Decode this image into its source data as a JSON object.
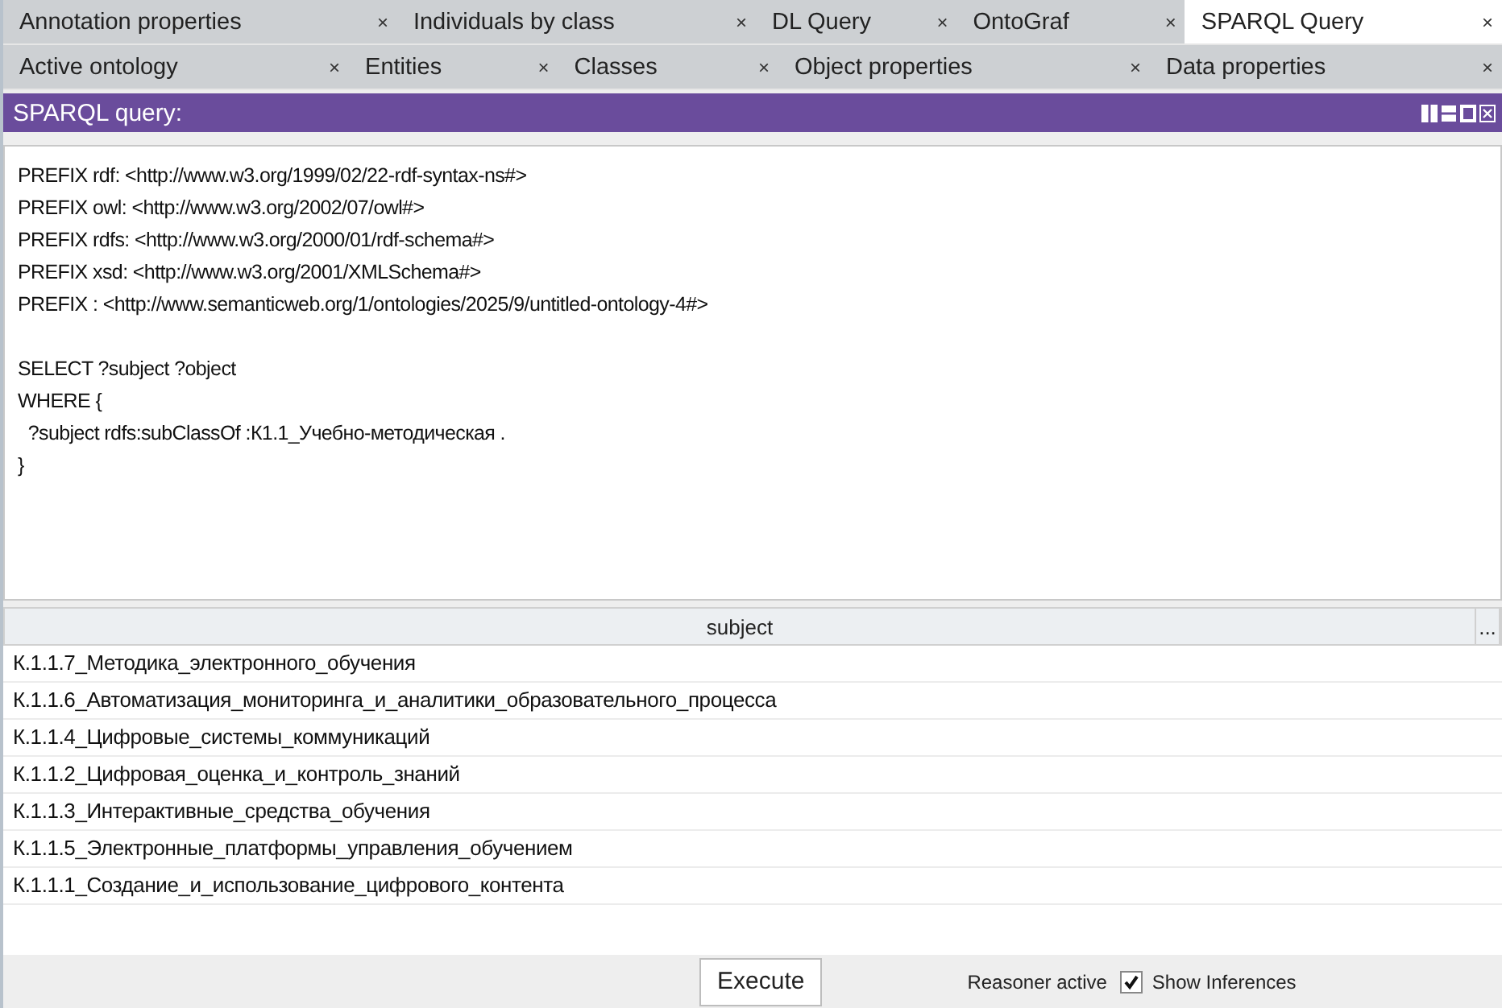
{
  "tab_rows": [
    [
      {
        "label": "Annotation properties",
        "close": "×",
        "selected": false
      },
      {
        "label": "Individuals by class",
        "close": "×",
        "selected": false
      },
      {
        "label": "DL Query",
        "close": "×",
        "selected": false
      },
      {
        "label": "OntoGraf",
        "close": "×",
        "selected": false
      },
      {
        "label": "SPARQL Query",
        "close": "×",
        "selected": true
      }
    ],
    [
      {
        "label": "Active ontology",
        "close": "×",
        "selected": false
      },
      {
        "label": "Entities",
        "close": "×",
        "selected": false
      },
      {
        "label": "Classes",
        "close": "×",
        "selected": false
      },
      {
        "label": "Object properties",
        "close": "×",
        "selected": false
      },
      {
        "label": "Data properties",
        "close": "×",
        "selected": false
      }
    ]
  ],
  "panel": {
    "title": "SPARQL query:"
  },
  "query_blocks": [
    [
      "PREFIX rdf: <http://www.w3.org/1999/02/22-rdf-syntax-ns#>",
      "PREFIX owl: <http://www.w3.org/2002/07/owl#>",
      "PREFIX rdfs: <http://www.w3.org/2000/01/rdf-schema#>",
      "PREFIX xsd: <http://www.w3.org/2001/XMLSchema#>",
      "PREFIX : <http://www.semanticweb.org/1/ontologies/2025/9/untitled-ontology-4#>"
    ],
    [
      "SELECT ?subject ?object",
      "WHERE {",
      "  ?subject rdfs:subClassOf :К1.1_Учебно-методическая .",
      "}"
    ]
  ],
  "table": {
    "columns": [
      "subject",
      "..."
    ],
    "rows": [
      "К.1.1.7_Методика_электронного_обучения",
      "К.1.1.6_Автоматизация_мониторинга_и_аналитики_образовательного_процесса",
      "К.1.1.4_Цифровые_системы_коммуникаций",
      "К.1.1.2_Цифровая_оценка_и_контроль_знаний",
      "К.1.1.3_Интерактивные_средства_обучения",
      "К.1.1.5_Электронные_платформы_управления_обучением",
      "К.1.1.1_Создание_и_использование_цифрового_контента"
    ]
  },
  "footer": {
    "execute": "Execute",
    "reasoner": "Reasoner active",
    "show_inferences": {
      "label": "Show Inferences",
      "checked": true
    }
  }
}
